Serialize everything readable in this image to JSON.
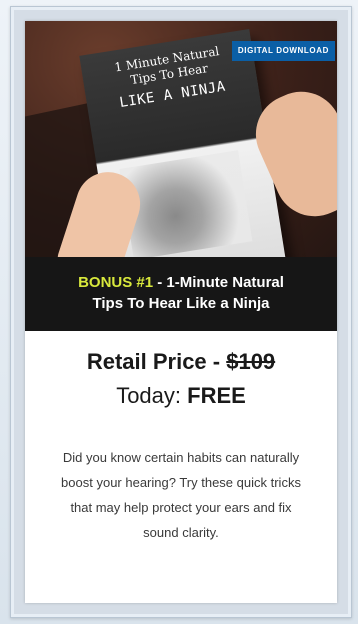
{
  "product": {
    "book_title_line1": "1 Minute Natural",
    "book_title_line2": "Tips To Hear",
    "book_title_line3": "LIKE A NINJA",
    "badge_text": "DIGITAL DOWNLOAD"
  },
  "bonus": {
    "tag": "BONUS #1",
    "title_part1": " - 1-Minute Natural",
    "title_part2": "Tips To Hear Like a Ninja"
  },
  "pricing": {
    "retail_label": "Retail Price - ",
    "retail_price": "$109",
    "today_label": "Today: ",
    "today_price": "FREE"
  },
  "description": "Did you know certain habits can naturally boost your hearing? Try these quick tricks that may help protect your ears and fix sound clarity.",
  "colors": {
    "bonus_tag": "#d8e83c",
    "badge_bg": "#0b5fa6",
    "bonus_bg": "#161616"
  }
}
